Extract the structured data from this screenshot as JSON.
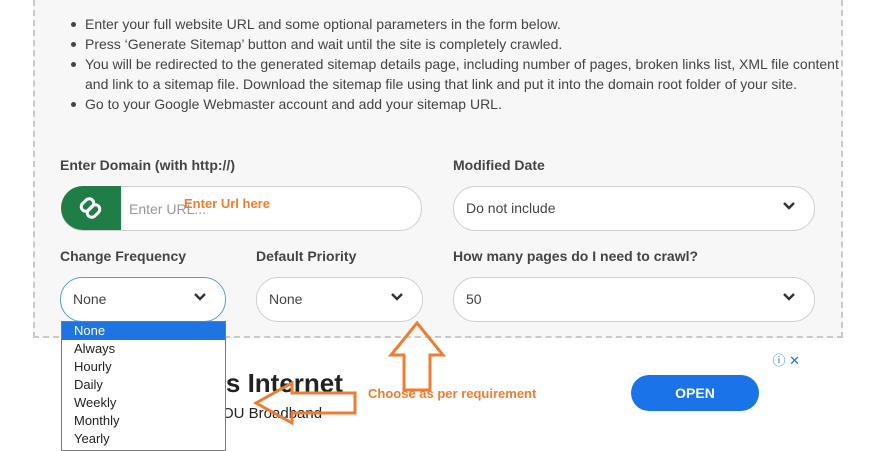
{
  "instructions": [
    "Enter your full website URL and some optional parameters in the form below.",
    "Press ‘Generate Sitemap’ button and wait until the site is completely crawled.",
    "You will be redirected to the generated sitemap details page, including number of pages, broken links list, XML file content and link to a sitemap file. Download the sitemap file using that link and put it into the domain root folder of your site.",
    "Go to your Google Webmaster account and add your sitemap URL."
  ],
  "form": {
    "domain_label": "Enter Domain (with http://)",
    "domain_placeholder": "Enter URL...",
    "modified_label": "Modified Date",
    "modified_value": "Do not include",
    "freq_label": "Change Frequency",
    "freq_value": "None",
    "priority_label": "Default Priority",
    "priority_value": "None",
    "pages_label": "How many pages do I need to crawl?",
    "pages_value": "50"
  },
  "dropdown_options": [
    "None",
    "Always",
    "Hourly",
    "Daily",
    "Weekly",
    "Monthly",
    "Yearly"
  ],
  "annotations": {
    "url_hint": "Enter Url here",
    "choose_hint": "Choose as per requirement"
  },
  "ad": {
    "title": "os Internet",
    "subtitle": "OU Broadband",
    "button": "OPEN",
    "icons": "ⓘ ✕"
  },
  "icons": {
    "link": "link-icon",
    "chevron": "chevron-down-icon"
  },
  "colors": {
    "accent_green": "#1e7e45",
    "annotation_orange": "#ed7d31",
    "ad_button_blue": "#1a73e8",
    "selected_option": "#1e74e0"
  }
}
